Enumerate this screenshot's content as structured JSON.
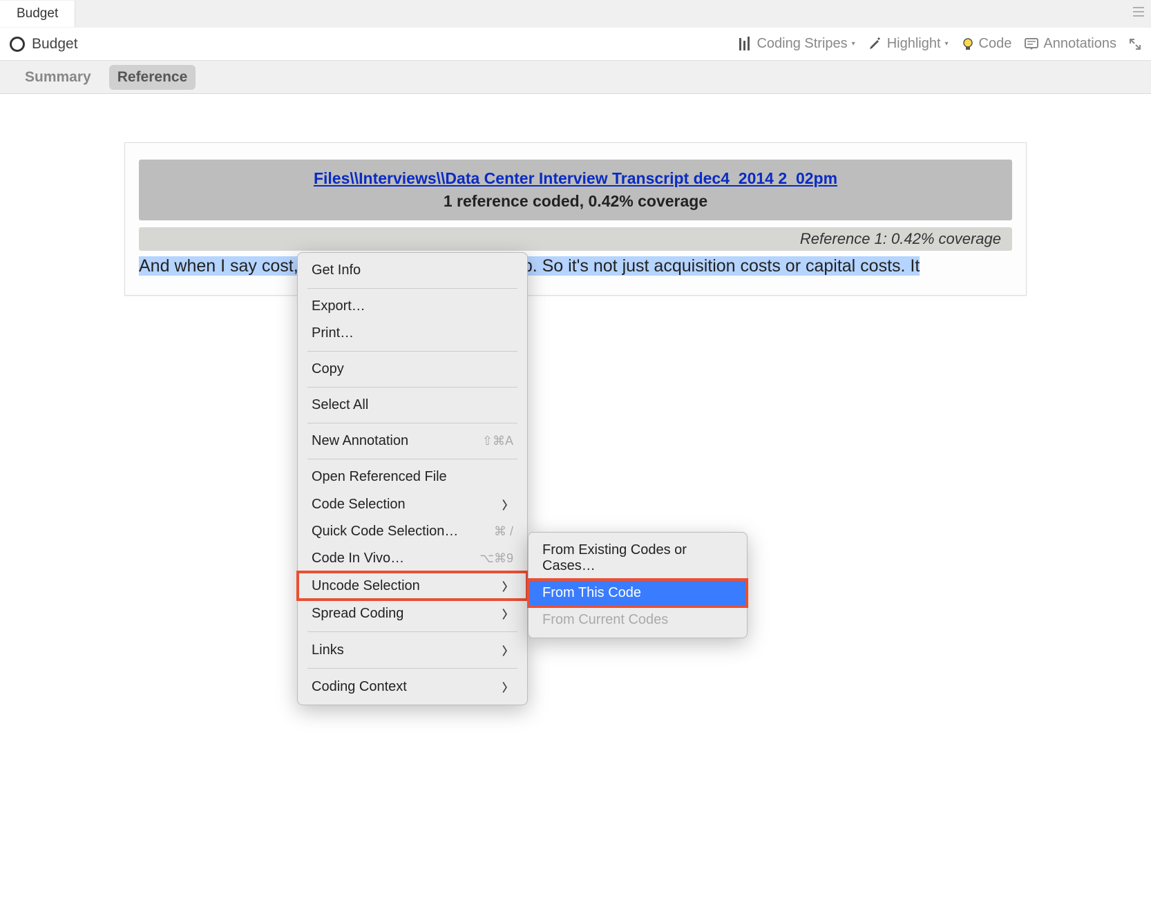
{
  "tab": {
    "label": "Budget"
  },
  "toolbar": {
    "title": "Budget",
    "coding_stripes": "Coding Stripes",
    "highlight": "Highlight",
    "code": "Code",
    "annotations": "Annotations"
  },
  "subtabs": {
    "summary": "Summary",
    "reference": "Reference"
  },
  "reference": {
    "file_link": "Files\\\\Interviews\\\\Data Center Interview Transcript dec4_2014 2_02pm",
    "coverage": "1 reference coded, 0.42% coverage",
    "ref_label": "Reference 1: 0.42% coverage",
    "excerpt_part1": "And when I say cost, I mean total cost of ownership.  So it's not just acquisition costs or capital costs.  It",
    "excerpt_part2": ""
  },
  "menu": {
    "get_info": "Get Info",
    "export": "Export…",
    "print": "Print…",
    "copy": "Copy",
    "select_all": "Select All",
    "new_annotation": "New Annotation",
    "new_annotation_shortcut": "⇧⌘A",
    "open_referenced": "Open Referenced File",
    "code_selection": "Code Selection",
    "quick_code": "Quick Code Selection…",
    "quick_code_shortcut": "⌘ /",
    "code_in_vivo": "Code In Vivo…",
    "code_in_vivo_shortcut": "⌥⌘9",
    "uncode_selection": "Uncode Selection",
    "spread_coding": "Spread Coding",
    "links": "Links",
    "coding_context": "Coding Context"
  },
  "submenu": {
    "from_existing": "From Existing Codes or Cases…",
    "from_this": "From This Code",
    "from_current": "From Current Codes"
  }
}
